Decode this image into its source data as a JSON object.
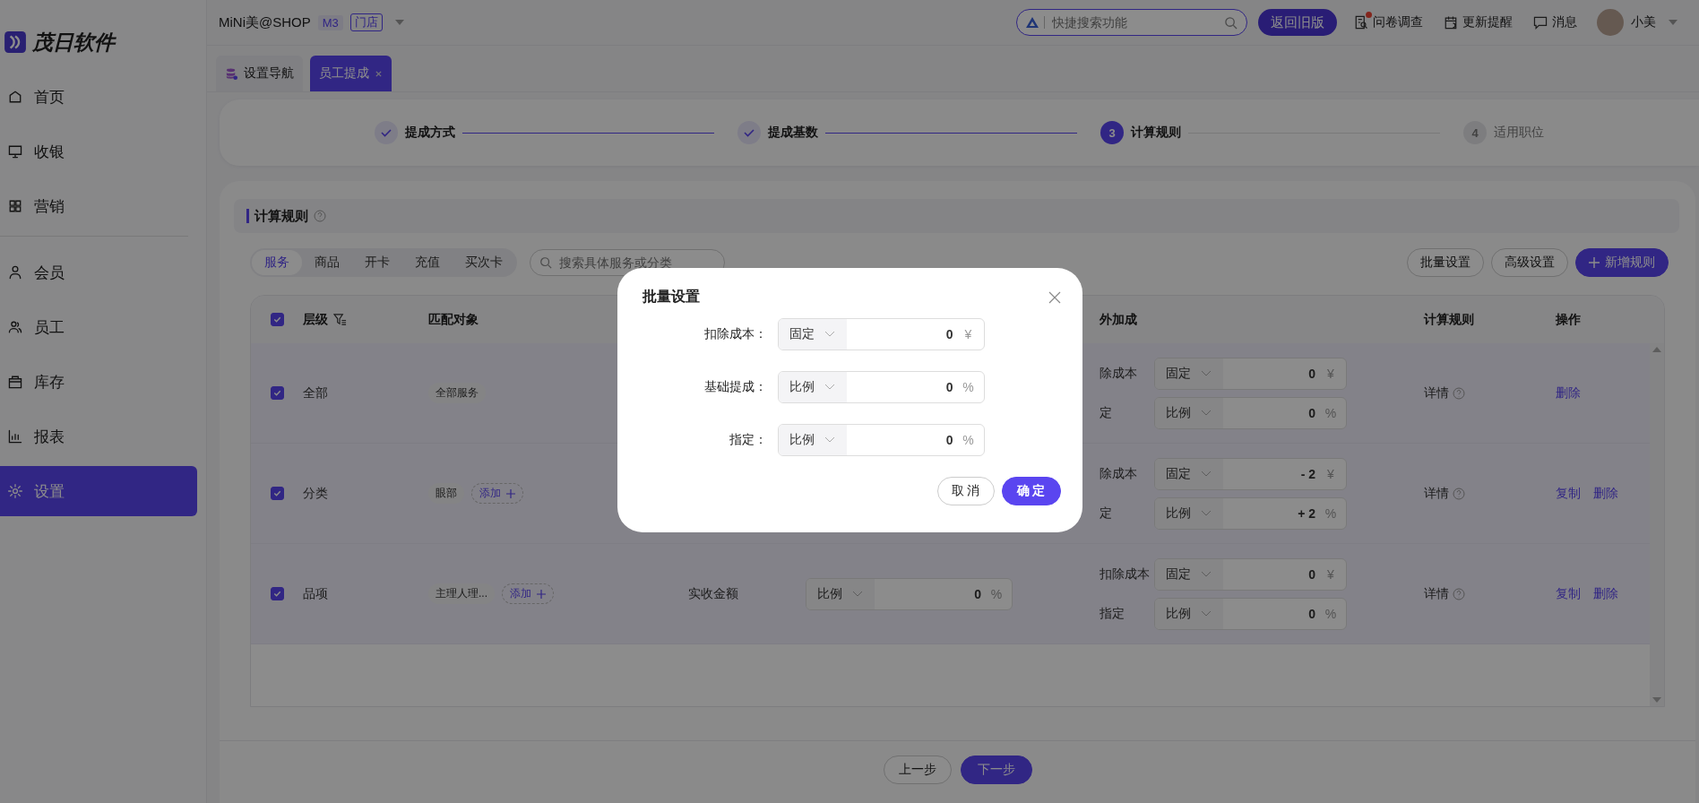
{
  "brand": {
    "name": "茂日软件"
  },
  "header": {
    "shop": "MiNi美@SHOP",
    "grade_badge": "M3",
    "store_tag": "门店",
    "search": {
      "placeholder": "快捷搜索功能"
    },
    "back_button": "返回旧版",
    "actions": [
      {
        "label": "问卷调查",
        "dot": true
      },
      {
        "label": "更新提醒",
        "dot": false
      },
      {
        "label": "消息",
        "dot": false
      }
    ],
    "user": "小美"
  },
  "sidebar": {
    "groups": [
      [
        {
          "label": "首页",
          "selected": false
        },
        {
          "label": "收银",
          "selected": false
        },
        {
          "label": "营销",
          "selected": false
        }
      ],
      [
        {
          "label": "会员",
          "selected": false
        },
        {
          "label": "员工",
          "selected": false
        },
        {
          "label": "库存",
          "selected": false
        },
        {
          "label": "报表",
          "selected": false
        },
        {
          "label": "设置",
          "selected": true
        }
      ]
    ]
  },
  "tabs": [
    {
      "label": "设置导航",
      "selected": false,
      "closable": false
    },
    {
      "label": "员工提成",
      "selected": true,
      "closable": true
    }
  ],
  "steps": [
    {
      "label": "提成方式",
      "completed": true,
      "active": false
    },
    {
      "label": "提成基数",
      "completed": true,
      "active": false
    },
    {
      "number": "3",
      "label": "计算规则",
      "completed": false,
      "active": true
    },
    {
      "number": "4",
      "label": "适用职位",
      "completed": false,
      "active": false
    }
  ],
  "section": {
    "title": "计算规则"
  },
  "filter_tabs": [
    {
      "label": "服务",
      "selected": true
    },
    {
      "label": "商品",
      "selected": false
    },
    {
      "label": "开卡",
      "selected": false
    },
    {
      "label": "充值",
      "selected": false
    },
    {
      "label": "买次卡",
      "selected": false
    }
  ],
  "filter_search": {
    "placeholder": "搜索具体服务或分类"
  },
  "toolbar": [
    {
      "label": "批量设置",
      "kind": "outline"
    },
    {
      "label": "高级设置",
      "kind": "outline"
    },
    {
      "label": "新增规则",
      "kind": "primary"
    }
  ],
  "table": {
    "all_checked": true,
    "columns": [
      {
        "label": "层级",
        "filter": true
      },
      {
        "label": "匹配对象"
      },
      {
        "label": "外加成"
      },
      {
        "label": "计算规则"
      },
      {
        "label": "操作"
      }
    ],
    "rows": [
      {
        "checked": true,
        "tier": "全部",
        "targets": [
          "全部服务"
        ],
        "extra": [
          {
            "label": "除成本",
            "mode": "固定",
            "value": "0",
            "unit": "¥"
          },
          {
            "label": "定",
            "mode": "比例",
            "value": "0",
            "unit": "%"
          }
        ],
        "detail": "详情",
        "actions": [
          "删除"
        ]
      },
      {
        "checked": true,
        "tier": "分类",
        "targets": [
          "眼部"
        ],
        "add": "添加",
        "extra": [
          {
            "label": "除成本",
            "mode": "固定",
            "value": "- 2",
            "unit": "¥"
          },
          {
            "label": "定",
            "mode": "比例",
            "value": "+ 2",
            "unit": "%"
          }
        ],
        "detail": "详情",
        "actions": [
          "复制",
          "删除"
        ]
      },
      {
        "checked": true,
        "tier": "品项",
        "targets": [
          "主理人理..."
        ],
        "add": "添加",
        "base": {
          "label": "实收金额",
          "mode": "比例",
          "value": "0",
          "unit": "%"
        },
        "extra": [
          {
            "label": "扣除成本",
            "mode": "固定",
            "value": "0",
            "unit": "¥"
          },
          {
            "label": "指定",
            "mode": "比例",
            "value": "0",
            "unit": "%"
          }
        ],
        "detail": "详情",
        "actions": [
          "复制",
          "删除"
        ]
      }
    ]
  },
  "footer": {
    "prev": "上一步",
    "next": "下一步"
  },
  "modal": {
    "title": "批量设置",
    "fields": [
      {
        "label": "扣除成本：",
        "mode": "固定",
        "value": "0",
        "unit": "¥"
      },
      {
        "label": "基础提成：",
        "mode": "比例",
        "value": "0",
        "unit": "%"
      },
      {
        "label": "指定：",
        "mode": "比例",
        "value": "0",
        "unit": "%"
      }
    ],
    "cancel": "取 消",
    "confirm": "确 定"
  }
}
